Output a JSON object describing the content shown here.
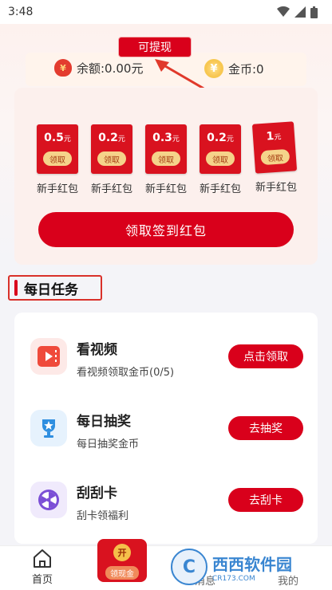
{
  "status_bar": {
    "time": "3:48"
  },
  "withdraw_tip": "可提现",
  "balance": {
    "label": "余额:0.00元",
    "coins_label": "金币:0"
  },
  "packets": [
    {
      "amount": "0.5",
      "unit": "元",
      "claim": "领取",
      "label": "新手红包"
    },
    {
      "amount": "0.2",
      "unit": "元",
      "claim": "领取",
      "label": "新手红包"
    },
    {
      "amount": "0.3",
      "unit": "元",
      "claim": "领取",
      "label": "新手红包"
    },
    {
      "amount": "0.2",
      "unit": "元",
      "claim": "领取",
      "label": "新手红包"
    },
    {
      "amount": "1",
      "unit": "元",
      "claim": "领取",
      "label": "新手红包"
    }
  ],
  "sign_button": "领取签到红包",
  "section_title": "每日任务",
  "tasks": [
    {
      "icon": "video-icon",
      "title": "看视频",
      "desc": "看视频领取金币(0/5)",
      "button": "点击领取"
    },
    {
      "icon": "trophy-icon",
      "title": "每日抽奖",
      "desc": "每日抽奖金币",
      "button": "去抽奖"
    },
    {
      "icon": "wheel-icon",
      "title": "刮刮卡",
      "desc": "刮卡领福利",
      "button": "去刮卡"
    }
  ],
  "nav": {
    "home": "首页",
    "redpack_open": "开",
    "redpack": "领现金",
    "messages": "消息",
    "mine": "我的"
  },
  "watermark": {
    "big": "西西软件园",
    "small": "CR173.COM",
    "logo": "C"
  },
  "colors": {
    "accent": "#d9001b",
    "panel": "#fcf0ed"
  }
}
